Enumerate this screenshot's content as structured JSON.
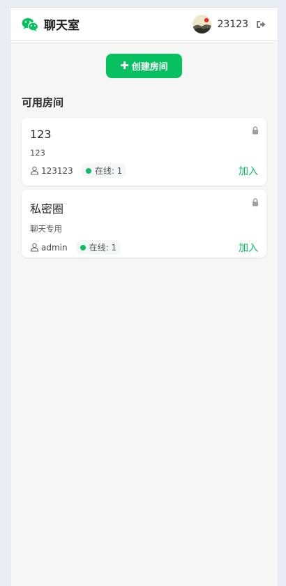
{
  "header": {
    "app_title": "聊天室",
    "username": "23123",
    "brand_color": "#07c160"
  },
  "actions": {
    "create_room_label": "创建房间"
  },
  "rooms_section": {
    "title": "可用房间",
    "rooms": [
      {
        "name": "123",
        "description": "123",
        "owner": "123123",
        "online_text": "在线: 1",
        "join_label": "加入",
        "locked": true
      },
      {
        "name": "私密圈",
        "description": "聊天专用",
        "owner": "admin",
        "online_text": "在线: 1",
        "join_label": "加入",
        "locked": true
      }
    ]
  }
}
